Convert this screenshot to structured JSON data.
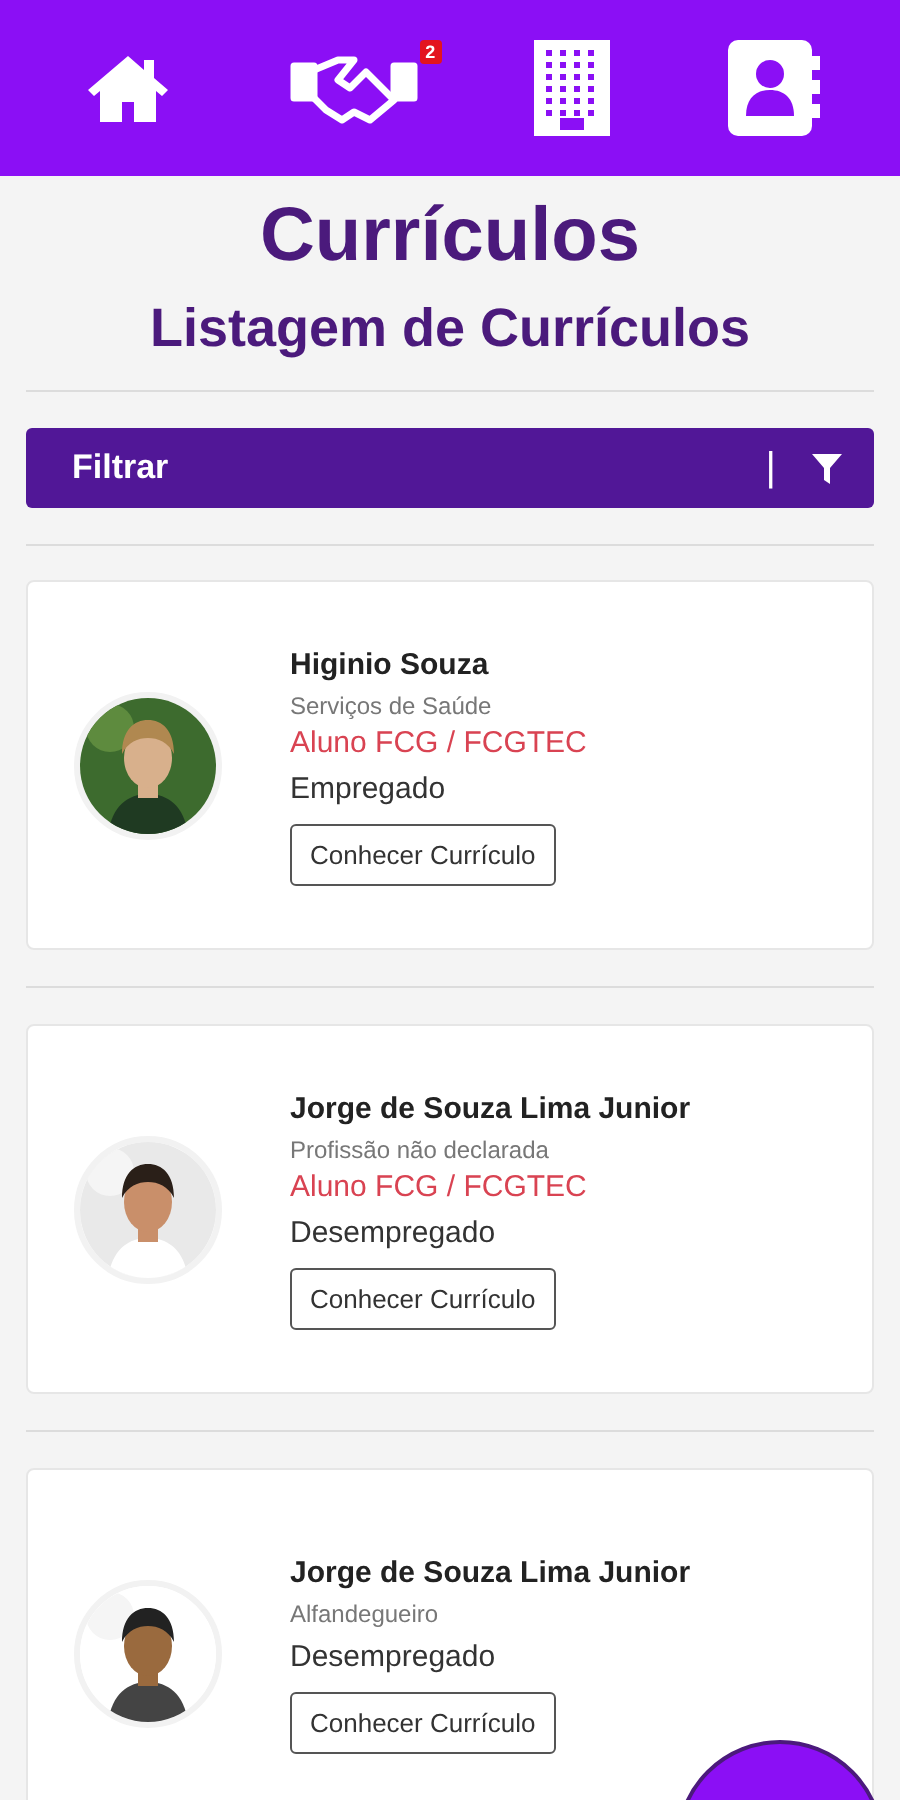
{
  "nav": {
    "items": [
      {
        "kind": "home"
      },
      {
        "kind": "handshake",
        "badge": "2"
      },
      {
        "kind": "building"
      },
      {
        "kind": "contacts"
      }
    ]
  },
  "title": "Currículos",
  "subtitle": "Listagem de Currículos",
  "filter": {
    "label": "Filtrar",
    "separator": "|"
  },
  "resumes": [
    {
      "name": "Higinio Souza",
      "profession": "Serviços de Saúde",
      "affiliation": "Aluno FCG / FCGTEC",
      "status": "Empregado",
      "button": "Conhecer Currículo"
    },
    {
      "name": "Jorge de Souza Lima Junior",
      "profession": "Profissão não declarada",
      "affiliation": "Aluno FCG / FCGTEC",
      "status": "Desempregado",
      "button": "Conhecer Currículo"
    },
    {
      "name": "Jorge de Souza Lima Junior",
      "profession": "Alfandegueiro",
      "status": "Desempregado",
      "button": "Conhecer Currículo"
    }
  ]
}
